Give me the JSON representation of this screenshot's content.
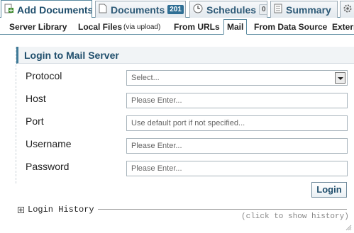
{
  "tabs": [
    {
      "label": "Add Documents",
      "badge": null
    },
    {
      "label": "Documents",
      "badge": "201"
    },
    {
      "label": "Schedules",
      "badge": "0"
    },
    {
      "label": "Summary",
      "badge": null
    }
  ],
  "subtabs": {
    "server_library": "Server Library",
    "local_files": "Local Files",
    "local_files_note": "(via upload)",
    "from_urls": "From URLs",
    "mail": "Mail",
    "from_data_source": "From Data Source",
    "external": "Extern"
  },
  "panel": {
    "title": "Login to Mail Server",
    "protocol": {
      "label": "Protocol",
      "value": "Select..."
    },
    "host": {
      "label": "Host",
      "placeholder": "Please Enter..."
    },
    "port": {
      "label": "Port",
      "placeholder": "Use default port if not specified..."
    },
    "username": {
      "label": "Username",
      "placeholder": "Please Enter..."
    },
    "password": {
      "label": "Password",
      "placeholder": "Please Enter..."
    },
    "login_button": "Login"
  },
  "history": {
    "label": "Login History",
    "hint": "(click to show history)"
  }
}
